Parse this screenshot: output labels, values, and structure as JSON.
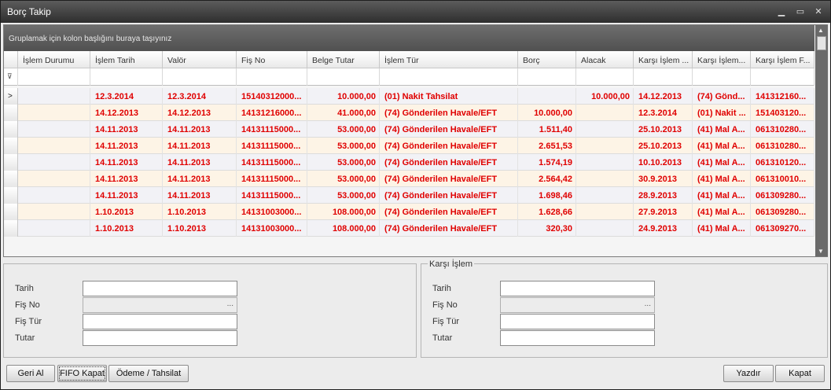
{
  "window": {
    "title": "Borç Takip",
    "minimize_icon": "minimize-icon",
    "maximize_icon": "maximize-icon",
    "close_icon": "close-icon"
  },
  "group_panel_text": "Gruplamak için kolon başlığını buraya taşıyınız",
  "columns": [
    "İşlem Durumu",
    "İşlem Tarih",
    "Valör",
    "Fiş No",
    "Belge Tutar",
    "İşlem Tür",
    "Borç",
    "Alacak",
    "Karşı İşlem ...",
    "Karşı İşlem...",
    "Karşı İşlem F..."
  ],
  "rows": [
    [
      "",
      "12.3.2014",
      "12.3.2014",
      "15140312000...",
      "10.000,00",
      "(01) Nakit Tahsilat",
      "",
      "10.000,00",
      "14.12.2013",
      "(74) Gönd...",
      "141312160..."
    ],
    [
      "",
      "14.12.2013",
      "14.12.2013",
      "14131216000...",
      "41.000,00",
      "(74) Gönderilen Havale/EFT",
      "10.000,00",
      "",
      "12.3.2014",
      "(01) Nakit ...",
      "151403120..."
    ],
    [
      "",
      "14.11.2013",
      "14.11.2013",
      "14131115000...",
      "53.000,00",
      "(74) Gönderilen Havale/EFT",
      "1.511,40",
      "",
      "25.10.2013",
      "(41) Mal A...",
      "061310280..."
    ],
    [
      "",
      "14.11.2013",
      "14.11.2013",
      "14131115000...",
      "53.000,00",
      "(74) Gönderilen Havale/EFT",
      "2.651,53",
      "",
      "25.10.2013",
      "(41) Mal A...",
      "061310280..."
    ],
    [
      "",
      "14.11.2013",
      "14.11.2013",
      "14131115000...",
      "53.000,00",
      "(74) Gönderilen Havale/EFT",
      "1.574,19",
      "",
      "10.10.2013",
      "(41) Mal A...",
      "061310120..."
    ],
    [
      "",
      "14.11.2013",
      "14.11.2013",
      "14131115000...",
      "53.000,00",
      "(74) Gönderilen Havale/EFT",
      "2.564,42",
      "",
      "30.9.2013",
      "(41) Mal A...",
      "061310010..."
    ],
    [
      "",
      "14.11.2013",
      "14.11.2013",
      "14131115000...",
      "53.000,00",
      "(74) Gönderilen Havale/EFT",
      "1.698,46",
      "",
      "28.9.2013",
      "(41) Mal A...",
      "061309280..."
    ],
    [
      "",
      "1.10.2013",
      "1.10.2013",
      "14131003000...",
      "108.000,00",
      "(74) Gönderilen Havale/EFT",
      "1.628,66",
      "",
      "27.9.2013",
      "(41) Mal A...",
      "061309280..."
    ],
    [
      "",
      "1.10.2013",
      "1.10.2013",
      "14131003000...",
      "108.000,00",
      "(74) Gönderilen Havale/EFT",
      "320,30",
      "",
      "24.9.2013",
      "(41) Mal A...",
      "061309270..."
    ]
  ],
  "current_row_marker": ">",
  "left_panel": {
    "tarih_label": "Tarih",
    "fis_no_label": "Fiş No",
    "fis_tur_label": "Fiş Tür",
    "tutar_label": "Tutar",
    "tarih_value": "",
    "fis_no_value": "",
    "fis_tur_value": "",
    "tutar_value": ""
  },
  "right_panel": {
    "legend": "Karşı İşlem",
    "tarih_label": "Tarih",
    "fis_no_label": "Fiş No",
    "fis_tur_label": "Fiş Tür",
    "tutar_label": "Tutar",
    "tarih_value": "",
    "fis_no_value": "",
    "fis_tur_value": "",
    "tutar_value": ""
  },
  "ellipsis": "...",
  "buttons": {
    "geri_al": "Geri Al",
    "fifo_kapat": "FIFO Kapat",
    "odeme_tahsilat": "Ödeme / Tahsilat",
    "yazdir": "Yazdır",
    "kapat": "Kapat"
  },
  "colors": {
    "row_text": "#e00000",
    "title_bar": "#3a3a3a"
  }
}
